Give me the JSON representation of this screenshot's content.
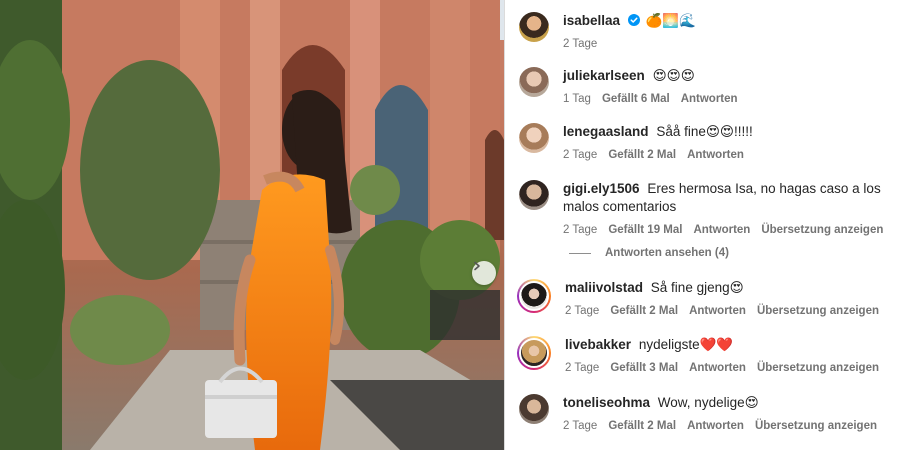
{
  "post": {
    "author": {
      "username": "isabellaa",
      "emojis": "🍊🌅🌊",
      "time": "2 Tage"
    },
    "next_icon": "chevron-right-icon"
  },
  "comments": [
    {
      "username": "juliekarlseen",
      "text": "😍😍😍",
      "time": "1 Tag",
      "likes": "Gefällt 6 Mal",
      "reply": "Antworten",
      "translate": ""
    },
    {
      "username": "lenegaasland",
      "text": "Såå fine😍😍!!!!!",
      "time": "2 Tage",
      "likes": "Gefällt 2 Mal",
      "reply": "Antworten",
      "translate": ""
    },
    {
      "username": "gigi.ely1506",
      "text": "Eres hermosa Isa, no hagas caso a los malos comentarios",
      "time": "2 Tage",
      "likes": "Gefällt 19 Mal",
      "reply": "Antworten",
      "translate": "Übersetzung anzeigen"
    },
    {
      "username": "maliivolstad",
      "text": "Så fine gjeng😍",
      "time": "2 Tage",
      "likes": "Gefällt 2 Mal",
      "reply": "Antworten",
      "translate": "Übersetzung anzeigen"
    },
    {
      "username": "livebakker",
      "text": "nydeligste❤️❤️",
      "time": "2 Tage",
      "likes": "Gefällt 3 Mal",
      "reply": "Antworten",
      "translate": "Übersetzung anzeigen"
    },
    {
      "username": "toneliseohma",
      "text": "Wow, nydelige😍",
      "time": "2 Tage",
      "likes": "Gefällt 2 Mal",
      "reply": "Antworten",
      "translate": "Übersetzung anzeigen"
    }
  ],
  "view_replies": "Antworten ansehen (4)",
  "colors": {
    "verified": "#0095f6",
    "secondary_text": "#737373",
    "primary_text": "#262626"
  }
}
